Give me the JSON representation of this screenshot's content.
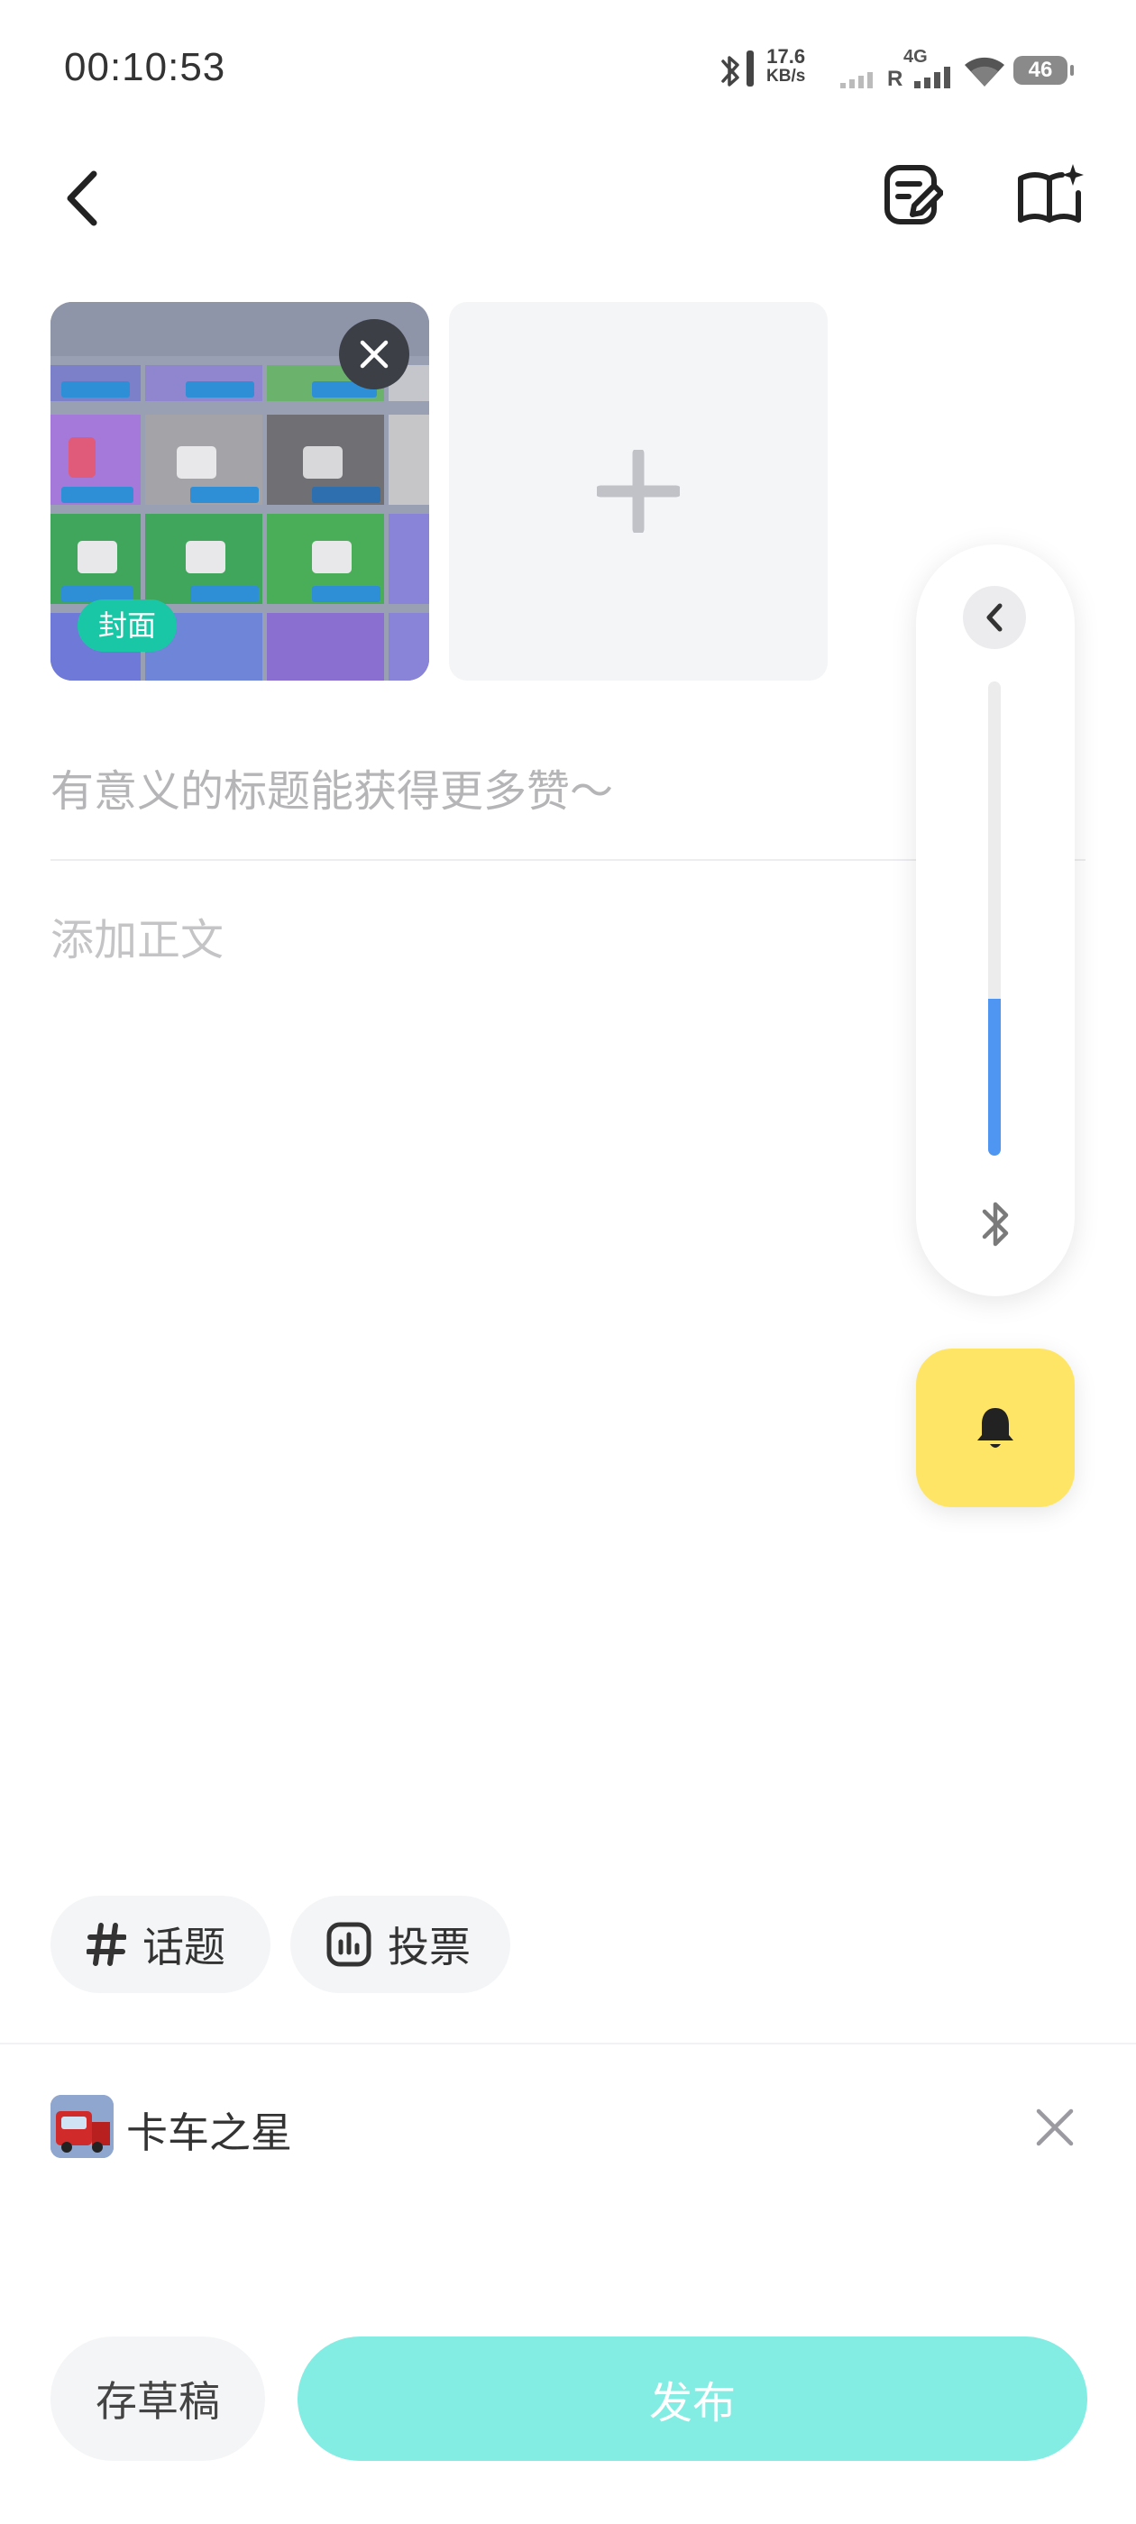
{
  "status_bar": {
    "time": "00:10:53",
    "net_speed_value": "17.6",
    "net_speed_unit": "KB/s",
    "network_type": "4G",
    "roaming": "R",
    "battery": "46"
  },
  "media": {
    "cover_badge": "封面"
  },
  "editor": {
    "title_placeholder": "有意义的标题能获得更多赞～",
    "body_placeholder": "添加正文"
  },
  "chips": {
    "topic": "话题",
    "vote": "投票"
  },
  "game": {
    "name": "卡车之星"
  },
  "buttons": {
    "draft": "存草稿",
    "publish": "发布"
  },
  "floating_panel": {
    "volume_level": 0.33
  },
  "colors": {
    "accent": "#19c7a6",
    "publish_bg": "#83ece3",
    "bell_bg": "#ffe566",
    "slider_fill": "#4f95f2"
  },
  "icons": {
    "back": "back-arrow-icon",
    "drafts": "edit-note-icon",
    "guide": "book-sparkle-icon",
    "add": "plus-icon",
    "bell": "bell-icon",
    "bluetooth": "bluetooth-icon"
  }
}
